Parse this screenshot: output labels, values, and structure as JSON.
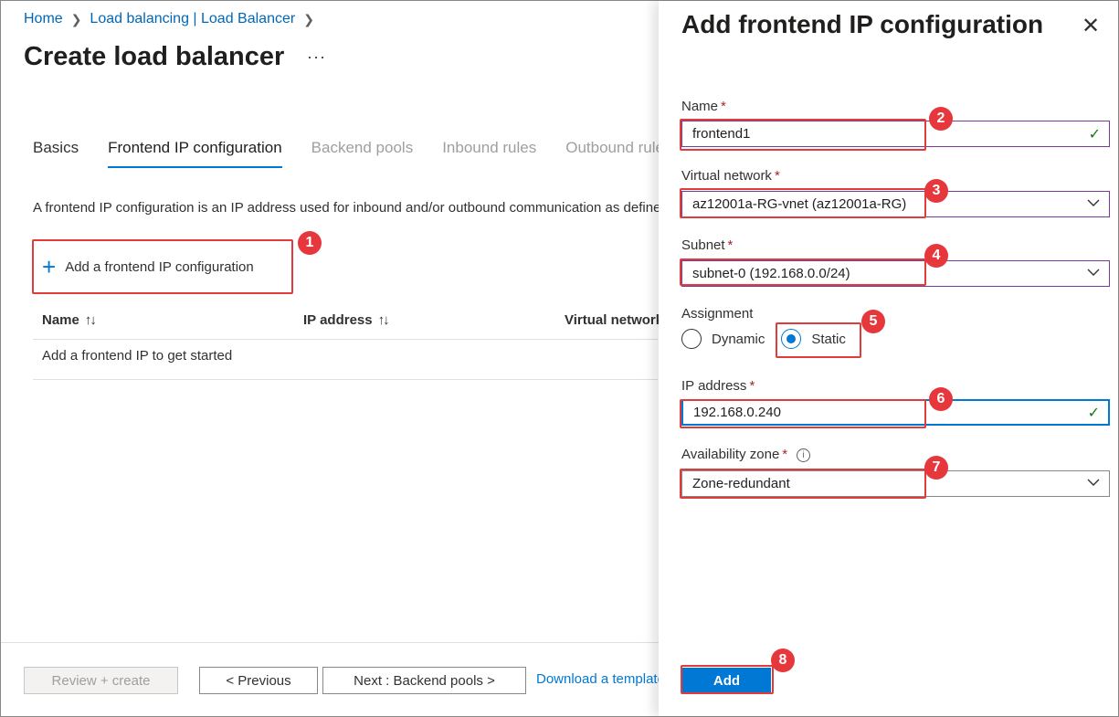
{
  "breadcrumb": {
    "home": "Home",
    "parent": "Load balancing | Load Balancer"
  },
  "page_title": "Create load balancer",
  "more_label": "···",
  "tabs": [
    {
      "label": "Basics"
    },
    {
      "label": "Frontend IP configuration"
    },
    {
      "label": "Backend pools"
    },
    {
      "label": "Inbound rules"
    },
    {
      "label": "Outbound rules"
    }
  ],
  "description": "A frontend IP configuration is an IP address used for inbound and/or outbound communication as defined within load balancing",
  "add_config_label": "Add a frontend IP configuration",
  "table": {
    "columns": [
      "Name",
      "IP address",
      "Virtual network"
    ],
    "sort_glyph": "↑↓",
    "empty_text": "Add a frontend IP to get started"
  },
  "footer": {
    "review": "Review + create",
    "previous": "< Previous",
    "next": "Next : Backend pools >",
    "download": "Download a template for automation"
  },
  "panel": {
    "title": "Add frontend IP configuration",
    "close": "✕",
    "name_label": "Name",
    "name_value": "frontend1",
    "vnet_label": "Virtual network",
    "vnet_value": "az12001a-RG-vnet (az12001a-RG)",
    "subnet_label": "Subnet",
    "subnet_value": "subnet-0 (192.168.0.0/24)",
    "assignment_label": "Assignment",
    "assignment_options": [
      "Dynamic",
      "Static"
    ],
    "assignment_selected": "Static",
    "ip_label": "IP address",
    "ip_value": "192.168.0.240",
    "zone_label": "Availability zone",
    "zone_value": "Zone-redundant",
    "required_mark": "*",
    "info_glyph": "i",
    "check_glyph": "✓",
    "add_button": "Add"
  },
  "callouts": [
    "1",
    "2",
    "3",
    "4",
    "5",
    "6",
    "7",
    "8"
  ],
  "colors": {
    "accent": "#0078d4",
    "callout": "#e5373c",
    "valid": "#107c10",
    "required": "#a4262c"
  }
}
